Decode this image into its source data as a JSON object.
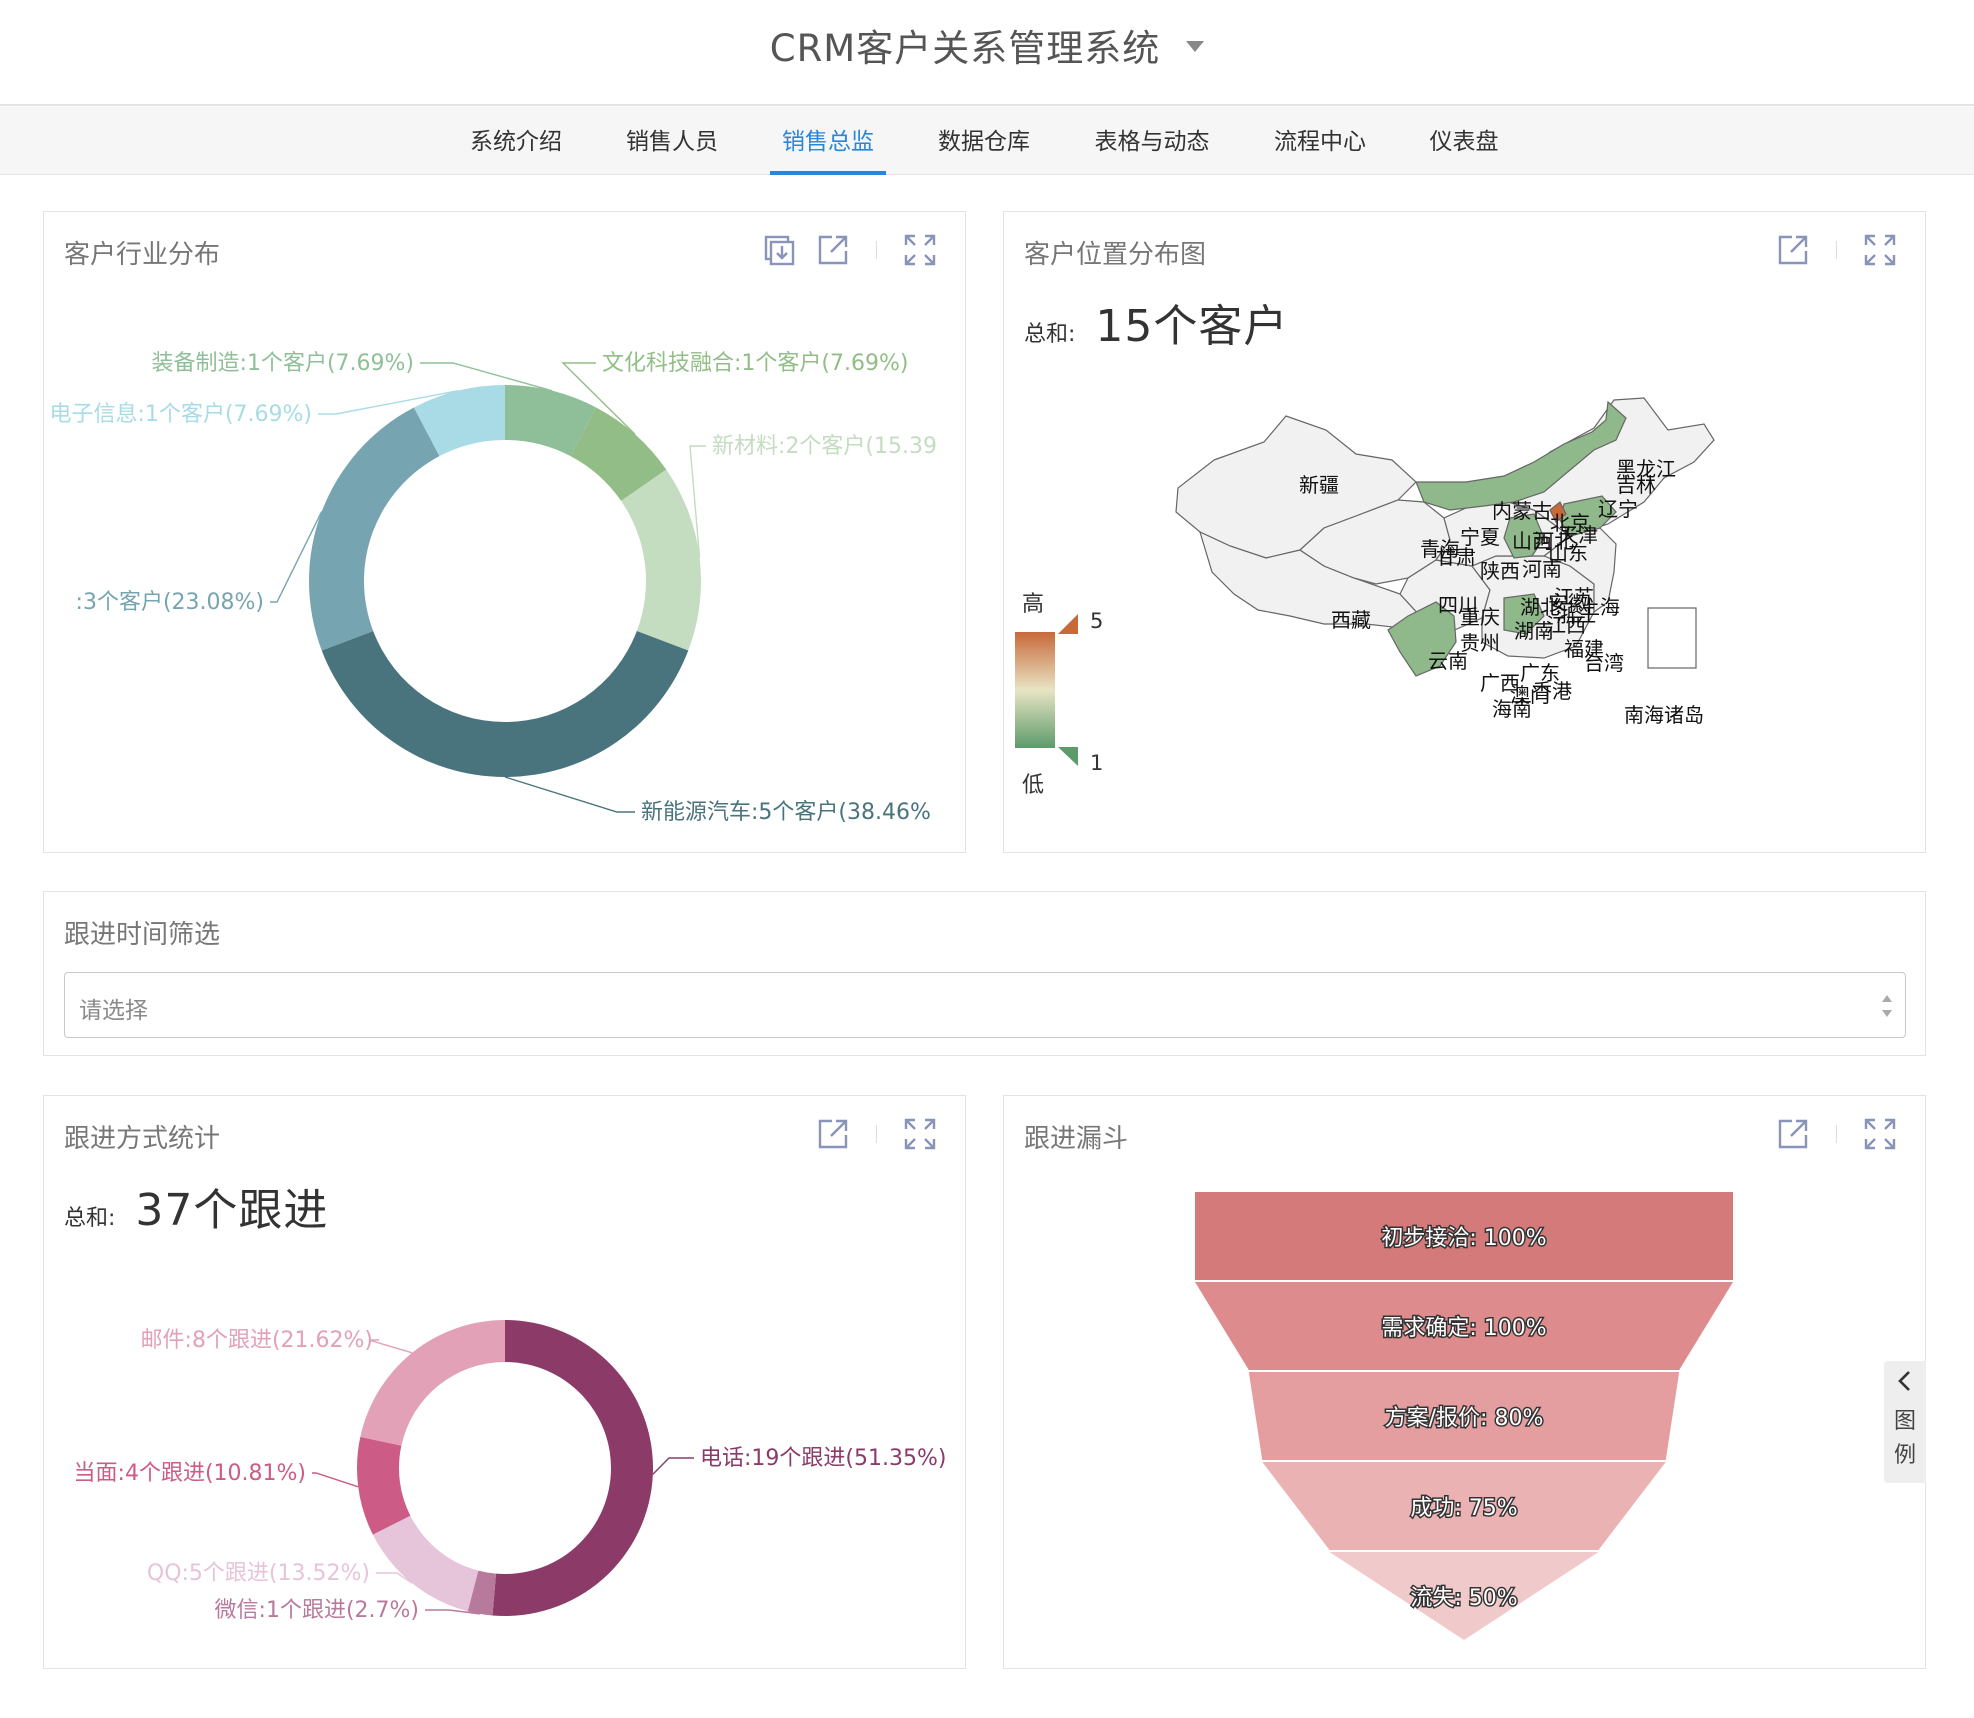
{
  "header": {
    "title": "CRM客户关系管理系统"
  },
  "tabs": [
    {
      "label": "系统介绍"
    },
    {
      "label": "销售人员"
    },
    {
      "label": "销售总监",
      "active": true
    },
    {
      "label": "数据仓库"
    },
    {
      "label": "表格与动态"
    },
    {
      "label": "流程中心"
    },
    {
      "label": "仪表盘"
    }
  ],
  "industry": {
    "title": "客户行业分布",
    "icons": [
      "download-icon",
      "open-external-icon",
      "fullscreen-icon"
    ]
  },
  "location": {
    "title": "客户位置分布图",
    "sum_label": "总和:",
    "sum_value": "15个客户",
    "scale": {
      "high_label": "高",
      "low_label": "低",
      "max": "5",
      "min": "1",
      "high_color": "#c8693a",
      "low_color": "#5c9b6a"
    },
    "provinces": [
      "新疆",
      "西藏",
      "青海",
      "甘肃",
      "内蒙古",
      "黑龙江",
      "吉林",
      "辽宁",
      "北京",
      "天津",
      "河北",
      "山西",
      "宁夏",
      "陕西",
      "山东",
      "河南",
      "江苏",
      "安徽",
      "上海",
      "四川",
      "重庆",
      "湖北",
      "浙江",
      "湖南",
      "江西",
      "贵州",
      "云南",
      "福建",
      "台湾",
      "广东",
      "广西",
      "香港",
      "澳门",
      "海南",
      "南海诸岛"
    ]
  },
  "filter": {
    "title": "跟进时间筛选",
    "placeholder": "请选择"
  },
  "followup_method": {
    "title": "跟进方式统计",
    "sum_label": "总和:",
    "sum_value": "37个跟进"
  },
  "funnel": {
    "title": "跟进漏斗",
    "legend_toggle": "图例"
  },
  "chart_data": [
    {
      "type": "pie",
      "title": "客户行业分布",
      "donut": true,
      "slices": [
        {
          "label": "装备制造:1个客户(7.69%)",
          "name": "装备制造",
          "value": 1,
          "percent": 7.69,
          "color": "#8fbf98"
        },
        {
          "label": "文化科技融合:1个客户(7.69%)",
          "name": "文化科技融合",
          "value": 1,
          "percent": 7.69,
          "color": "#92bd86"
        },
        {
          "label": "新材料:2个客户(15.39",
          "name": "新材料",
          "value": 2,
          "percent": 15.39,
          "color": "#c4dcc0"
        },
        {
          "label": "新能源汽车:5个客户(38.46%",
          "name": "新能源汽车",
          "value": 5,
          "percent": 38.46,
          "color": "#4a747d"
        },
        {
          "label": ":3个客户(23.08%)",
          "name": "",
          "value": 3,
          "percent": 23.08,
          "color": "#76a5b1"
        },
        {
          "label": "电子信息:1个客户(7.69%)",
          "name": "电子信息",
          "value": 1,
          "percent": 7.69,
          "color": "#a8dbe6"
        }
      ]
    },
    {
      "type": "pie",
      "title": "跟进方式统计",
      "donut": true,
      "slices": [
        {
          "label": "电话:19个跟进(51.35%)",
          "name": "电话",
          "value": 19,
          "percent": 51.35,
          "color": "#8c3b68"
        },
        {
          "label": "微信:1个跟进(2.7%)",
          "name": "微信",
          "value": 1,
          "percent": 2.7,
          "color": "#b87a9c"
        },
        {
          "label": "QQ:5个跟进(13.52%)",
          "name": "QQ",
          "value": 5,
          "percent": 13.52,
          "color": "#e6c4d9"
        },
        {
          "label": "当面:4个跟进(10.81%)",
          "name": "当面",
          "value": 4,
          "percent": 10.81,
          "color": "#cc5c86"
        },
        {
          "label": "邮件:8个跟进(21.62%)",
          "name": "邮件",
          "value": 8,
          "percent": 21.62,
          "color": "#e2a1b7"
        }
      ]
    },
    {
      "type": "funnel",
      "title": "跟进漏斗",
      "stages": [
        {
          "label": "初步接洽: 100%",
          "name": "初步接洽",
          "value": 100,
          "color": "#d57a7b"
        },
        {
          "label": "需求确定: 100%",
          "name": "需求确定",
          "value": 100,
          "color": "#dd8b8c"
        },
        {
          "label": "方案/报价: 80%",
          "name": "方案/报价",
          "value": 80,
          "color": "#e49e9f"
        },
        {
          "label": "成功: 75%",
          "name": "成功",
          "value": 75,
          "color": "#eab2b3"
        },
        {
          "label": "流失: 50%",
          "name": "流失",
          "value": 50,
          "color": "#f0c9ca"
        }
      ]
    }
  ]
}
